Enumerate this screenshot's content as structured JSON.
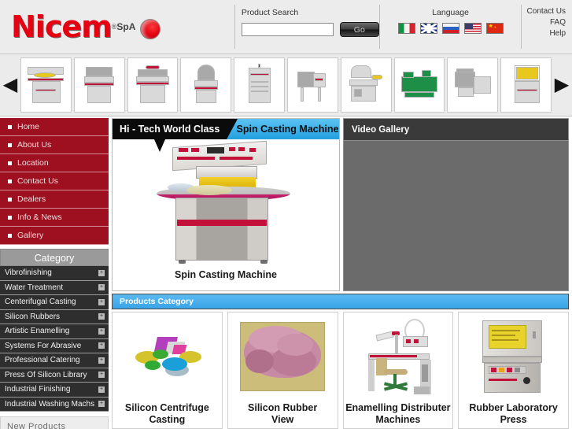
{
  "brand": {
    "name": "Nicem",
    "registered": "®",
    "suffix": "SpA"
  },
  "search": {
    "label": "Product Search",
    "value": "",
    "placeholder": "",
    "button": "Go"
  },
  "language": {
    "label": "Language",
    "flags": [
      {
        "name": "italian-flag",
        "code": "it"
      },
      {
        "name": "uk-flag",
        "code": "uk"
      },
      {
        "name": "russian-flag",
        "code": "ru"
      },
      {
        "name": "usa-flag",
        "code": "us"
      },
      {
        "name": "chinese-flag",
        "code": "cn"
      }
    ]
  },
  "top_links": [
    {
      "label": "Contact Us"
    },
    {
      "label": "FAQ"
    },
    {
      "label": "Help"
    }
  ],
  "carousel": {
    "prev_icon": "◀",
    "next_icon": "▶",
    "items": [
      {
        "name": "vibro-bowl-machine"
      },
      {
        "name": "washing-machine-unit"
      },
      {
        "name": "bench-finishing-machine"
      },
      {
        "name": "centrifugal-disc-machine"
      },
      {
        "name": "drying-cabinet"
      },
      {
        "name": "rotary-barrel-machine"
      },
      {
        "name": "catering-unit"
      },
      {
        "name": "green-grinding-machine"
      },
      {
        "name": "industrial-washer"
      },
      {
        "name": "control-cabinet-unit"
      }
    ]
  },
  "nav": {
    "items": [
      {
        "label": "Home"
      },
      {
        "label": "About Us"
      },
      {
        "label": "Location"
      },
      {
        "label": "Contact Us"
      },
      {
        "label": "Dealers"
      },
      {
        "label": "Info & News"
      },
      {
        "label": "Gallery"
      }
    ]
  },
  "category": {
    "header": "Category",
    "expand_icon": "+",
    "items": [
      {
        "label": "Vibrofinishing"
      },
      {
        "label": "Water Treatment"
      },
      {
        "label": "Centerifugal Casting"
      },
      {
        "label": "Silicon Rubbers"
      },
      {
        "label": "Artistic Enamelling"
      },
      {
        "label": "Systems For Abrasive"
      },
      {
        "label": "Professional Catering"
      },
      {
        "label": "Press Of Silicon Library"
      },
      {
        "label": "Industrial Finishing"
      },
      {
        "label": "Industrial Washing Machs"
      }
    ]
  },
  "new_products": {
    "header": "New Products"
  },
  "banner": {
    "tagline": "Hi - Tech World Class",
    "product": "Spin Casting Machine",
    "caption": "Spin Casting Machine"
  },
  "video_gallery": {
    "title": "Video Gallery"
  },
  "products_section": {
    "header": "Products Category",
    "cards": [
      {
        "title_line1": "Silicon Centrifuge",
        "title_line2": "Casting",
        "image": "colored-discs-image"
      },
      {
        "title_line1": "Silicon Rubber",
        "title_line2": "View",
        "image": "pink-rubber-mold-image"
      },
      {
        "title_line1": "Enamelling Distributer",
        "title_line2": "Machines",
        "image": "enamelling-workbench-image"
      },
      {
        "title_line1": "Rubber Laboratory",
        "title_line2": "Press",
        "image": "laboratory-press-image"
      }
    ]
  },
  "colors": {
    "brand_red": "#e60012",
    "nav_red": "#9e1020",
    "accent_blue": "#38a4e8",
    "category_dark": "#2e2e2e",
    "page_bg": "#ececec"
  }
}
